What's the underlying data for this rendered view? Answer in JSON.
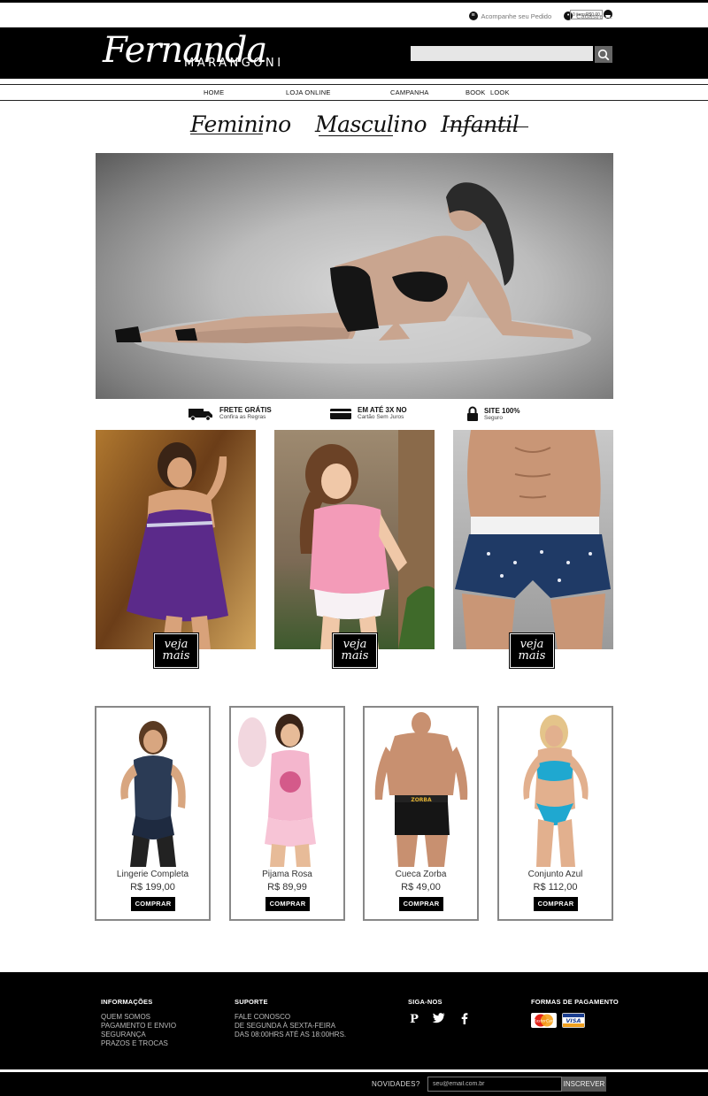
{
  "top_links": {
    "track_order": "Acompanhe seu Pedido",
    "register": "Cadastre-se",
    "cart_items": "0 itens",
    "cart_total": "R$0,00"
  },
  "brand": {
    "script": "Fernanda",
    "sub": "MARANGONI"
  },
  "search": {
    "placeholder": ""
  },
  "nav": [
    "HOME",
    "LOJA ONLINE",
    "CAMPANHA",
    "BOOK",
    "LOOK"
  ],
  "categories": [
    "Feminino",
    "Masculino",
    "Infantil"
  ],
  "benefits": [
    {
      "title": "FRETE GRÁTIS",
      "subtitle": "Confira as Regras",
      "icon": "delivery-truck-icon"
    },
    {
      "title": "EM ATÉ 3X NO",
      "subtitle": "Cartão Sem Juros",
      "icon": "credit-card-icon"
    },
    {
      "title": "SITE 100%",
      "subtitle": "Seguro",
      "icon": "padlock-icon"
    }
  ],
  "veja_mais": {
    "line1": "veja",
    "line2": "mais"
  },
  "products": [
    {
      "name": "Lingerie Completa",
      "price": "R$ 199,00",
      "button": "COMPRAR"
    },
    {
      "name": "Pijama Rosa",
      "price": "R$ 89,99",
      "button": "COMPRAR"
    },
    {
      "name": "Cueca Zorba",
      "price": "R$ 49,00",
      "button": "COMPRAR",
      "print": "ZORBA"
    },
    {
      "name": "Conjunto Azul",
      "price": "R$ 112,00",
      "button": "COMPRAR"
    }
  ],
  "footer": {
    "info": {
      "title": "INFORMAÇÕES",
      "links": [
        "QUEM SOMOS",
        "PAGAMENTO E ENVIO",
        "SEGURANÇA",
        "PRAZOS E TROCAS"
      ]
    },
    "support": {
      "title": "SUPORTE",
      "lines": [
        "FALE CONOSCO",
        "DE SEGUNDA À SEXTA-FEIRA",
        "DAS 08:00HRS ATÉ AS 18:00HRS."
      ]
    },
    "social": {
      "title": "SIGA-NOS",
      "icons": [
        "pinterest-icon",
        "twitter-icon",
        "facebook-icon"
      ]
    },
    "payment": {
      "title": "FORMAS DE PAGAMENTO",
      "methods": [
        "MasterCard",
        "VISA"
      ]
    }
  },
  "newsletter": {
    "label": "NOVIDADES?",
    "placeholder": "seu@email.com.br",
    "button": "INSCREVER"
  },
  "colors": {
    "black": "#000000",
    "border_gray": "#888888",
    "search_bg": "#e6e6e6"
  }
}
